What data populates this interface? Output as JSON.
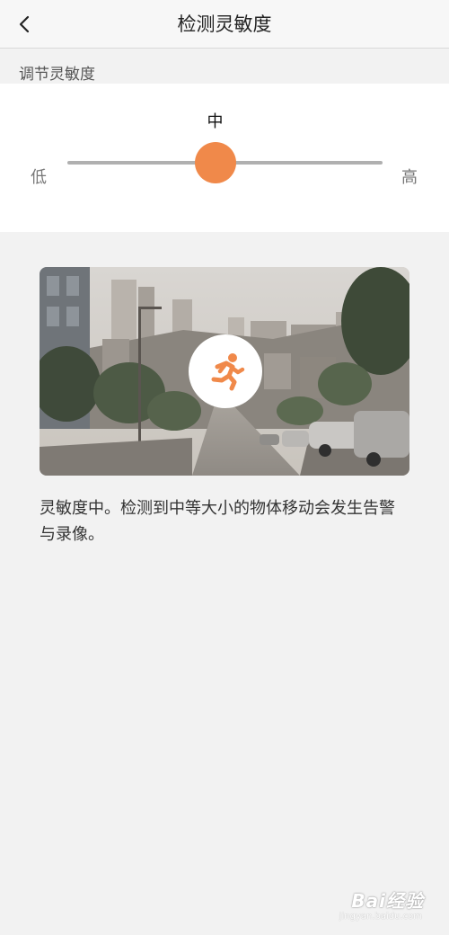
{
  "header": {
    "title": "检测灵敏度"
  },
  "sensitivity": {
    "section_label": "调节灵敏度",
    "current_value": "中",
    "low_label": "低",
    "high_label": "高",
    "level": 0.5,
    "accent_color": "#f0894a"
  },
  "preview": {
    "icon": "running-person-icon"
  },
  "description": "灵敏度中。检测到中等大小的物体移动会发生告警与录像。",
  "watermark": {
    "brand": "Bai经验",
    "url": "jingyan.baidu.com"
  }
}
